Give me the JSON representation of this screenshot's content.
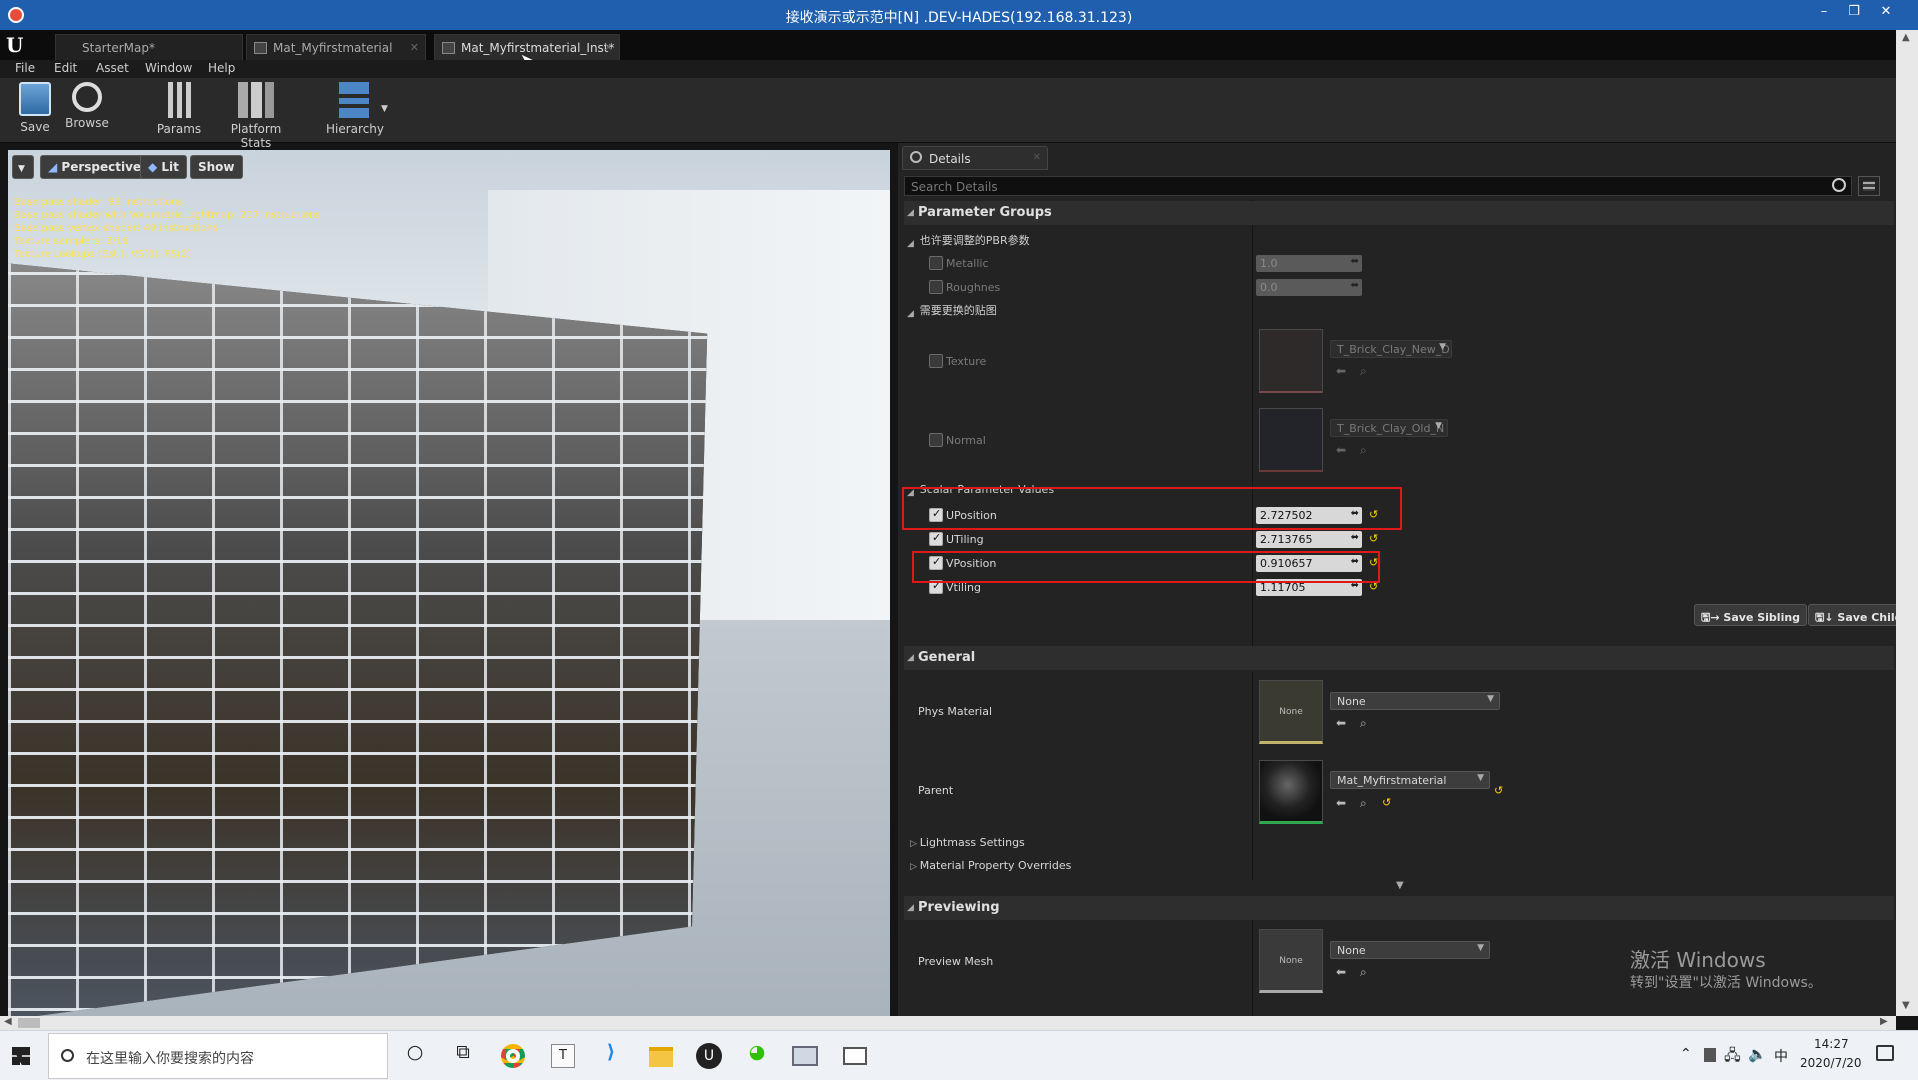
{
  "window": {
    "title": "接收演示或示范中[N] .DEV-HADES(192.168.31.123)",
    "minimize": "–",
    "restore": "❐",
    "close": "✕"
  },
  "tabs": [
    {
      "label": "StarterMap*"
    },
    {
      "label": "Mat_Myfirstmaterial"
    },
    {
      "label": "Mat_Myfirstmaterial_Inst*"
    }
  ],
  "menu": [
    "File",
    "Edit",
    "Asset",
    "Window",
    "Help"
  ],
  "toolbar": {
    "save": "Save",
    "browse": "Browse",
    "params": "Params",
    "platform_stats": "Platform Stats",
    "hierarchy": "Hierarchy"
  },
  "viewport": {
    "perspective": "Perspective",
    "lit": "Lit",
    "show": "Show",
    "stats": [
      "Base pass shader: 93 instructions",
      "Base pass shader with Volumetric Lightmap: 207 instructions",
      "Base pass vertex shader: 49 instructions",
      "Texture samplers: 3/16",
      "Texture Lookups (Est.): VS(0), PS(2)"
    ]
  },
  "details": {
    "tab": "Details",
    "search_placeholder": "Search Details",
    "parameter_groups": "Parameter Groups",
    "group1": "也许要调整的PBR参数",
    "metallic": {
      "label": "Metallic",
      "value": "1.0"
    },
    "roughness": {
      "label": "Roughnes",
      "value": "0.0"
    },
    "group2": "需要更换的贴图",
    "texture": {
      "label": "Texture",
      "asset": "T_Brick_Clay_New_D"
    },
    "normal": {
      "label": "Normal",
      "asset": "T_Brick_Clay_Old_N"
    },
    "scalar_group": "Scalar Parameter Values",
    "scalars": [
      {
        "label": "UPosition",
        "value": "2.727502"
      },
      {
        "label": "UTiling",
        "value": "2.713765"
      },
      {
        "label": "VPosition",
        "value": "0.910657"
      },
      {
        "label": "Vtiling",
        "value": "1.11705"
      }
    ],
    "save_sibling": "Save Sibling",
    "save_child": "Save Child",
    "general": "General",
    "phys_material": {
      "label": "Phys Material",
      "thumb": "None",
      "value": "None"
    },
    "parent": {
      "label": "Parent",
      "value": "Mat_Myfirstmaterial"
    },
    "lightmass": "Lightmass Settings",
    "material_overrides": "Material Property Overrides",
    "previewing": "Previewing",
    "preview_mesh": {
      "label": "Preview Mesh",
      "thumb": "None",
      "value": "None"
    }
  },
  "watermark": {
    "line1": "激活 Windows",
    "line2": "转到\"设置\"以激活 Windows。"
  },
  "taskbar": {
    "search_placeholder": "在这里输入你要搜索的内容",
    "time": "14:27",
    "date": "2020/7/20",
    "ime": "中"
  }
}
